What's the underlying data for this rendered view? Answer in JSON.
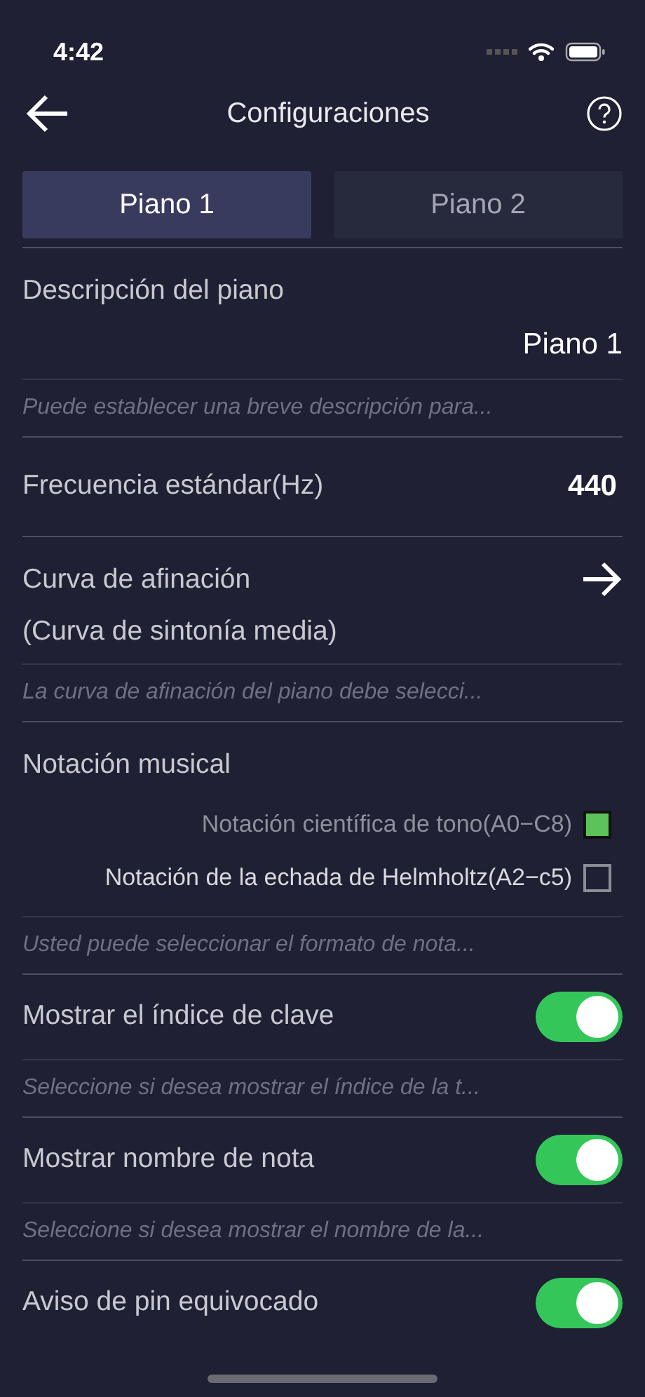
{
  "status_bar": {
    "time": "4:42"
  },
  "header": {
    "title": "Configuraciones"
  },
  "tabs": [
    {
      "label": "Piano 1",
      "selected": true
    },
    {
      "label": "Piano 2",
      "selected": false
    }
  ],
  "settings": [
    {
      "kind": "text",
      "label": "Descripción del piano",
      "value": "Piano 1",
      "hint": "Puede establecer una breve descripción para..."
    },
    {
      "kind": "number",
      "label": "Frecuencia estándar(Hz)",
      "value": "440"
    },
    {
      "kind": "link",
      "label": "Curva de afinación",
      "value": "(Curva de sintonía media)",
      "hint": "La curva de afinación del piano debe selecci..."
    },
    {
      "kind": "choice",
      "label": "Notación musical",
      "options": [
        {
          "label": "Notación científica de tono(A0−C8)",
          "checked": true
        },
        {
          "label": "Notación de la echada de Helmholtz(A2−c5)",
          "checked": false
        }
      ],
      "hint": "Usted puede seleccionar el formato de nota..."
    },
    {
      "kind": "toggle",
      "label": "Mostrar el índice de clave",
      "on": true,
      "hint": "Seleccione si desea mostrar el índice de la t..."
    },
    {
      "kind": "toggle",
      "label": "Mostrar nombre de nota",
      "on": true,
      "hint": "Seleccione si desea mostrar el nombre de la..."
    },
    {
      "kind": "toggle",
      "label": "Aviso de pin equivocado",
      "on": true
    }
  ]
}
